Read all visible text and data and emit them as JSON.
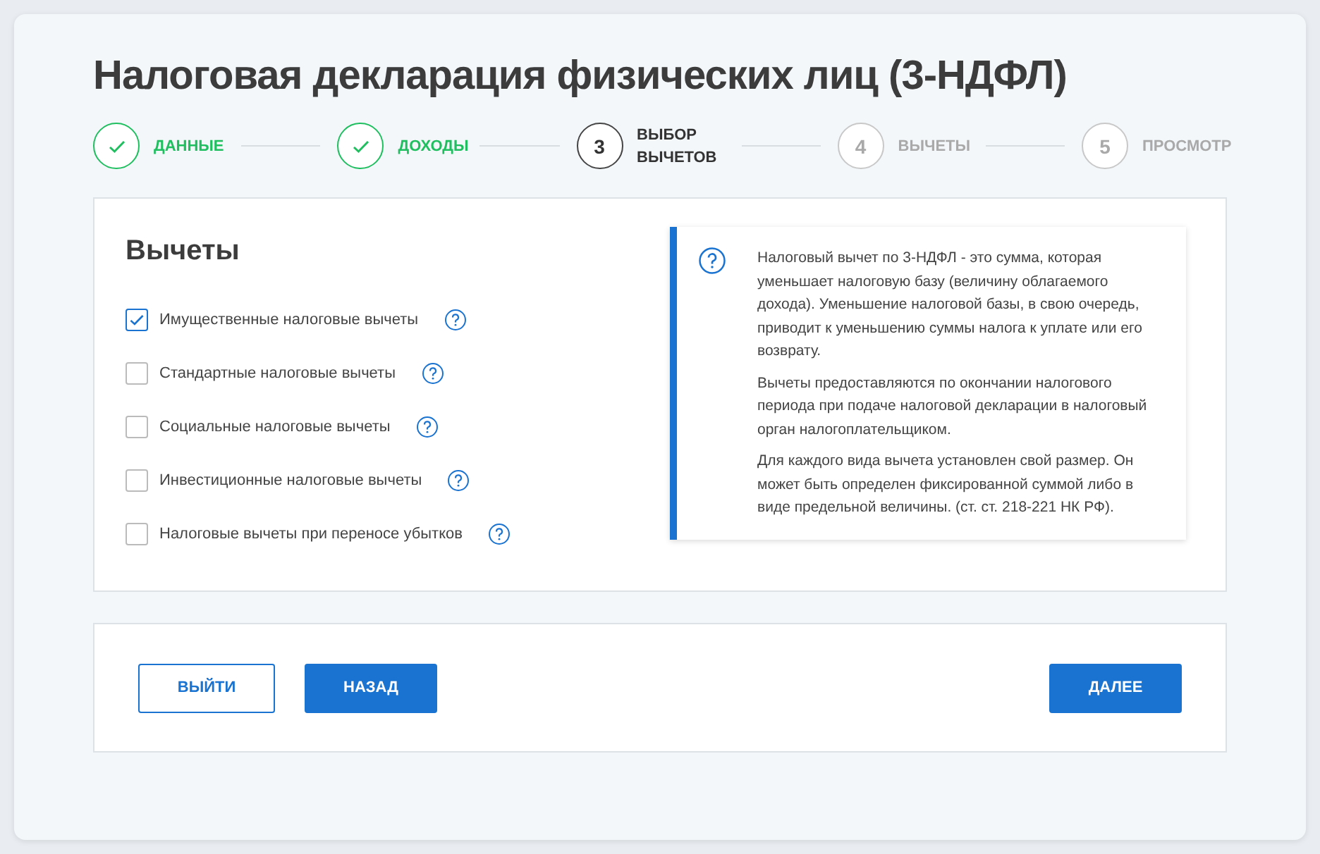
{
  "title": "Налоговая декларация физических лиц (3-НДФЛ)",
  "steps": [
    {
      "label": "ДАННЫЕ",
      "completed": true,
      "selected": false
    },
    {
      "label": "ДОХОДЫ",
      "completed": true,
      "selected": false
    },
    {
      "marker": "3",
      "label": "ВЫБОР ВЫЧЕТОВ",
      "completed": false,
      "selected": true
    },
    {
      "marker": "4",
      "label": "ВЫЧЕТЫ",
      "completed": false,
      "selected": false
    },
    {
      "marker": "5",
      "label": "ПРОСМОТР",
      "completed": false,
      "selected": false
    }
  ],
  "section_title": "Вычеты",
  "options": [
    {
      "label": "Имущественные налоговые вычеты",
      "checked": true
    },
    {
      "label": "Стандартные налоговые вычеты",
      "checked": false
    },
    {
      "label": "Социальные налоговые вычеты",
      "checked": false
    },
    {
      "label": "Инвестиционные налоговые вычеты",
      "checked": false
    },
    {
      "label": "Налоговые вычеты при переносе убытков",
      "checked": false
    }
  ],
  "info": [
    "Налоговый вычет по 3-НДФЛ - это сумма, которая уменьшает налоговую базу (величину облагаемого дохода). Уменьшение налоговой базы, в свою очередь, приводит к уменьшению суммы налога к уплате или его возврату.",
    "Вычеты предоставляются по окончании налогового периода при подаче налоговой декларации в налоговый орган налогоплательщиком.",
    "Для каждого вида вычета установлен свой размер. Он может быть определен фиксированной суммой либо в виде предельной величины. (ст. ст. 218-221 НК РФ)."
  ],
  "buttons": [
    {
      "label": "ВЫЙТИ",
      "kind": "outline"
    },
    {
      "label": "НАЗАД",
      "kind": "primary"
    },
    {
      "label": "ДАЛЕЕ",
      "kind": "primary"
    }
  ]
}
